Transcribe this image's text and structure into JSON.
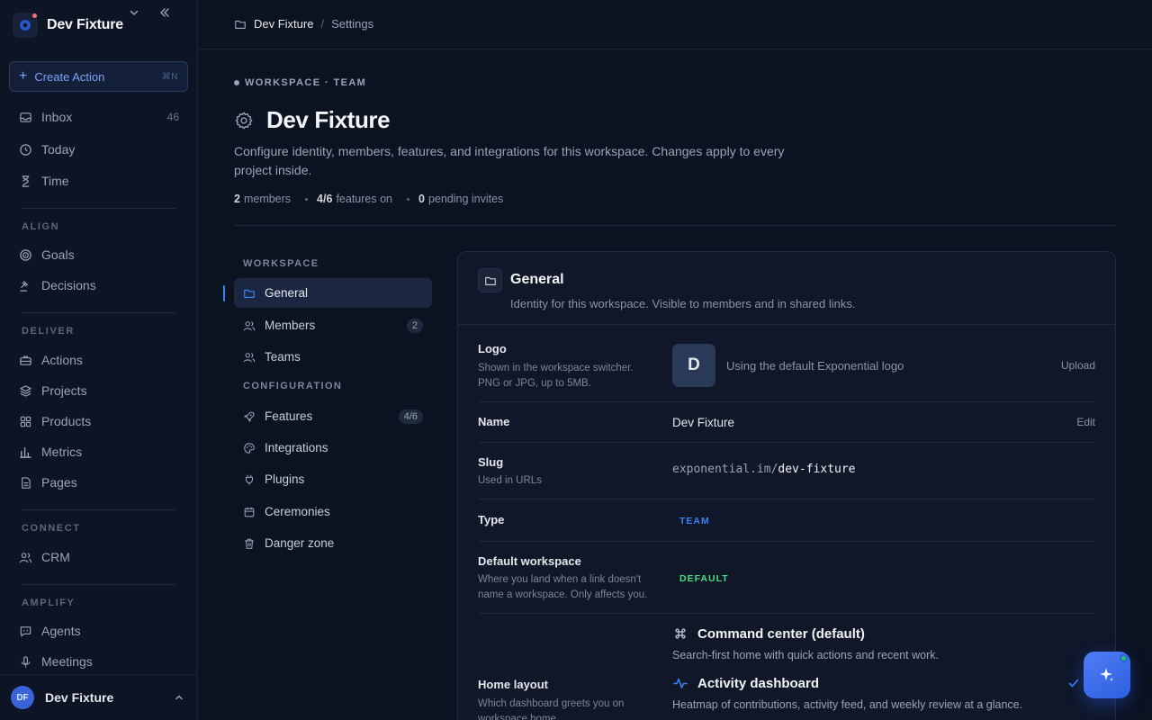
{
  "sidebar": {
    "workspace_name": "Dev Fixture",
    "create_action": {
      "label": "Create Action",
      "shortcut": "⌘N"
    },
    "primary_items": [
      {
        "label": "Inbox",
        "count": "46",
        "icon": "inbox-icon"
      },
      {
        "label": "Today",
        "icon": "clock-icon"
      },
      {
        "label": "Time",
        "icon": "hourglass-icon"
      }
    ],
    "sections": [
      {
        "label": "ALIGN",
        "items": [
          {
            "label": "Goals",
            "icon": "target-icon"
          },
          {
            "label": "Decisions",
            "icon": "gavel-icon"
          }
        ]
      },
      {
        "label": "DELIVER",
        "items": [
          {
            "label": "Actions",
            "icon": "briefcase-icon"
          },
          {
            "label": "Projects",
            "icon": "layers-icon"
          },
          {
            "label": "Products",
            "icon": "grid-icon"
          },
          {
            "label": "Metrics",
            "icon": "bar-chart-icon"
          },
          {
            "label": "Pages",
            "icon": "file-icon"
          }
        ]
      },
      {
        "label": "CONNECT",
        "items": [
          {
            "label": "CRM",
            "icon": "users-icon"
          }
        ]
      },
      {
        "label": "AMPLIFY",
        "items": [
          {
            "label": "Agents",
            "icon": "message-bot-icon"
          },
          {
            "label": "Meetings",
            "icon": "mic-icon"
          }
        ]
      }
    ],
    "user": {
      "initials": "DF",
      "name": "Dev Fixture"
    }
  },
  "breadcrumb": {
    "workspace": "Dev Fixture",
    "separator": "/",
    "page": "Settings"
  },
  "header": {
    "eyebrow": "WORKSPACE · TEAM",
    "title": "Dev Fixture",
    "description": "Configure identity, members, features, and integrations for this workspace. Changes apply to every project inside.",
    "stats": [
      {
        "value": "2",
        "label": "members"
      },
      {
        "value": "4/6",
        "label": "features on"
      },
      {
        "value": "0",
        "label": "pending invites"
      }
    ]
  },
  "settings_nav": {
    "workspace_label": "WORKSPACE",
    "workspace_items": [
      {
        "label": "General",
        "icon": "folder-icon",
        "active": true
      },
      {
        "label": "Members",
        "icon": "users-icon",
        "badge": "2"
      },
      {
        "label": "Teams",
        "icon": "users-icon"
      }
    ],
    "configuration_label": "CONFIGURATION",
    "configuration_items": [
      {
        "label": "Features",
        "icon": "rocket-icon",
        "badge": "4/6"
      },
      {
        "label": "Integrations",
        "icon": "palette-icon"
      },
      {
        "label": "Plugins",
        "icon": "plug-icon"
      },
      {
        "label": "Ceremonies",
        "icon": "calendar-icon"
      },
      {
        "label": "Danger zone",
        "icon": "trash-icon"
      }
    ]
  },
  "general": {
    "title": "General",
    "subtitle": "Identity for this workspace. Visible to members and in shared links.",
    "logo": {
      "label": "Logo",
      "help": "Shown in the workspace switcher. PNG or JPG, up to 5MB.",
      "letter": "D",
      "status": "Using the default Exponential logo",
      "action": "Upload"
    },
    "name": {
      "label": "Name",
      "value": "Dev Fixture",
      "action": "Edit"
    },
    "slug": {
      "label": "Slug",
      "help": "Used in URLs",
      "prefix": "exponential.im/",
      "value": "dev-fixture"
    },
    "type": {
      "label": "Type",
      "value": "TEAM"
    },
    "default_workspace": {
      "label": "Default workspace",
      "help": "Where you land when a link doesn't name a workspace. Only affects you.",
      "value": "DEFAULT"
    },
    "home_layout": {
      "label": "Home layout",
      "help": "Which dashboard greets you on workspace home.",
      "options": [
        {
          "title": "Command center (default)",
          "description": "Search-first home with quick actions and recent work.",
          "icon": "command-icon",
          "selected": false
        },
        {
          "title": "Activity dashboard",
          "description": "Heatmap of contributions, activity feed, and weekly review at a glance.",
          "icon": "activity-icon",
          "selected": true
        }
      ]
    }
  },
  "colors": {
    "accent": "#3b82f6",
    "success": "#4ade80",
    "background": "#0b1220",
    "sidebar": "#0d1424"
  }
}
